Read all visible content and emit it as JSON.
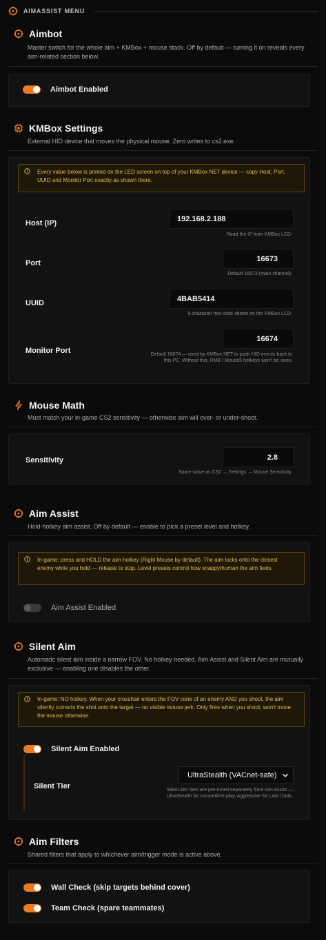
{
  "menu": {
    "title": "AIMASSIST MENU"
  },
  "colors": {
    "accent": "#ea7b22",
    "warning_text": "#e3bb53",
    "background": "#0b0b0b"
  },
  "aimbot": {
    "title": "Aimbot",
    "description": "Master switch for the whole aim + KMBox + mouse stack. Off by default — turning it on reveals every aim-related section below.",
    "toggle_label": "Aimbot Enabled",
    "enabled": true
  },
  "kmbox": {
    "title": "KMBox Settings",
    "description": "External HID device that moves the physical mouse. Zero writes to cs2.exe.",
    "notice": "Every value below is printed on the LED screen on top of your KMBox NET device — copy Host, Port, UUID and Monitor Port exactly as shown there.",
    "host": {
      "label": "Host (IP)",
      "value": "192.168.2.188",
      "hint": "Read the IP from KMBox LCD."
    },
    "port": {
      "label": "Port",
      "value": "16673",
      "hint": "Default 16673 (main channel)."
    },
    "uuid": {
      "label": "UUID",
      "value": "4BAB5414",
      "hint": "8-character hex code shown on the KMBox LCD."
    },
    "monitor_port": {
      "label": "Monitor Port",
      "value": "16674",
      "hint": "Default 16674 — used by KMBox NET to push HID events back to this PC. Without this, RMB / Mouse5 hotkeys won't be seen."
    }
  },
  "mouse_math": {
    "title": "Mouse Math",
    "description": "Must match your in-game CS2 sensitivity — otherwise aim will over- or under-shoot.",
    "sensitivity": {
      "label": "Sensitivity",
      "value": "2.8",
      "hint": "Same value as CS2 → Settings → Mouse Sensitivity."
    }
  },
  "aim_assist": {
    "title": "Aim Assist",
    "description": "Hold-hotkey aim assist. Off by default — enable to pick a preset level and hotkey.",
    "notice": "In-game: press and HOLD the aim hotkey (Right Mouse by default). The aim locks onto the closest enemy while you hold — release to stop. Level presets control how snappy/human the aim feels.",
    "toggle_label": "Aim Assist Enabled",
    "enabled": false
  },
  "silent_aim": {
    "title": "Silent Aim",
    "description": "Automatic silent aim inside a narrow FOV. No hotkey needed. Aim Assist and Silent Aim are mutually exclusive — enabling one disables the other.",
    "notice": "In-game: NO hotkey. When your crosshair enters the FOV cone of an enemy AND you shoot, the aim silently corrects the shot onto the target — no visible mouse jerk. Only fires when you shoot; won't move the mouse otherwise.",
    "toggle_label": "Silent Aim Enabled",
    "enabled": true,
    "tier": {
      "label": "Silent Tier",
      "value": "UltraStealth (VACnet-safe)",
      "hint": "Silent Aim tiers are pre-tuned separately from Aim Assist — UltraStealth for competitive play, Aggressive for LAN / bots."
    }
  },
  "aim_filters": {
    "title": "Aim Filters",
    "description": "Shared filters that apply to whichever aim/trigger mode is active above.",
    "wall_check": {
      "label": "Wall Check (skip targets behind cover)",
      "enabled": true
    },
    "team_check": {
      "label": "Team Check (spare teammates)",
      "enabled": true
    }
  }
}
